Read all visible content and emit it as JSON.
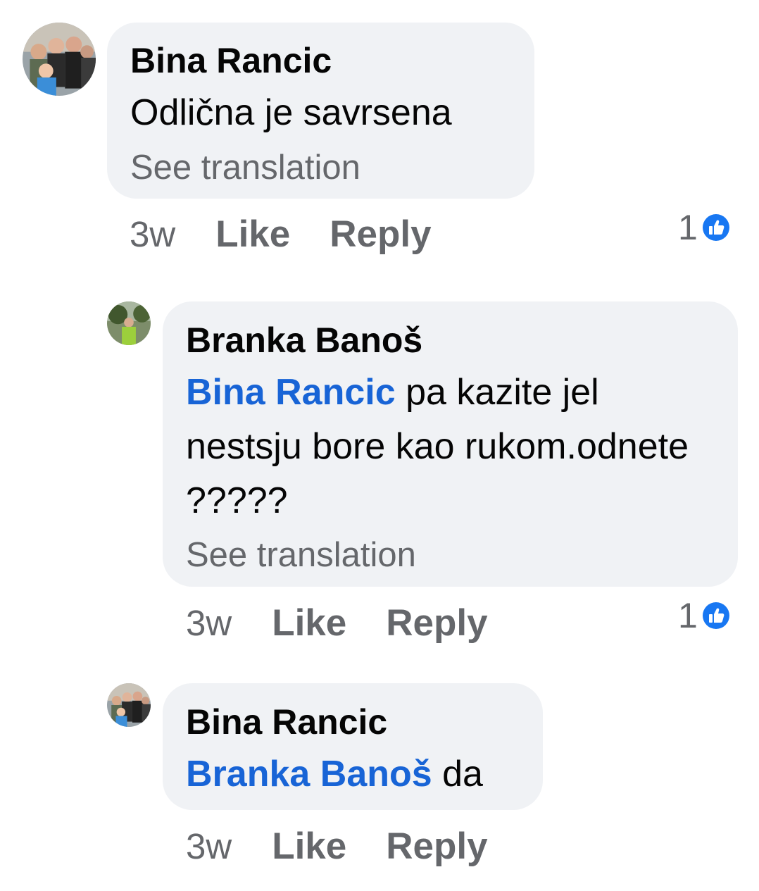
{
  "comments": [
    {
      "author": "Bina Rancic",
      "mention": "",
      "text": "Odlična je savrsena",
      "see_translation": "See translation",
      "time": "3w",
      "like_label": "Like",
      "reply_label": "Reply",
      "reaction_count": "1"
    },
    {
      "author": "Branka Banoš",
      "mention": "Bina Rancic",
      "text": "pa kazite jel nestsju bore kao rukom.odnete ?????",
      "see_translation": "See translation",
      "time": "3w",
      "like_label": "Like",
      "reply_label": "Reply",
      "reaction_count": "1"
    },
    {
      "author": "Bina Rancic",
      "mention": "Branka Banoš",
      "text": "da",
      "see_translation": "",
      "time": "3w",
      "like_label": "Like",
      "reply_label": "Reply",
      "reaction_count": ""
    }
  ],
  "colors": {
    "bubble_bg": "#f0f2f5",
    "mention": "#1864d6",
    "secondary_text": "#65676b",
    "like_badge": "#1877f2"
  },
  "icons": {
    "reaction": "like-thumbs-up-icon"
  }
}
